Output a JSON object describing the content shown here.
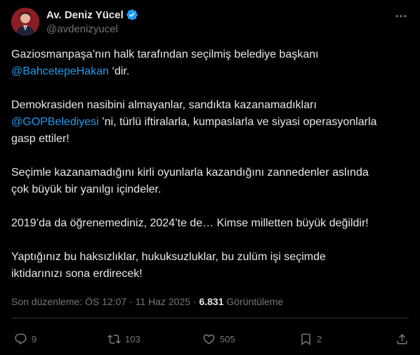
{
  "user": {
    "display_name": "Av. Deniz Yücel",
    "handle": "@avdenizyucel",
    "verified_color": "#1d9bf0"
  },
  "tweet": {
    "paragraphs": [
      {
        "lines": [
          [
            {
              "t": "Gaziosmanpaşa’nın halk tarafından seçilmiş belediye başkanı"
            }
          ],
          [
            {
              "t": "@BahcetepeHakan",
              "m": true
            },
            {
              "t": " ‘dir."
            }
          ]
        ]
      },
      {
        "lines": [
          [
            {
              "t": "Demokrasiden nasibini almayanlar, sandıkta kazanamadıkları"
            }
          ],
          [
            {
              "t": "@GOPBelediyesi",
              "m": true
            },
            {
              "t": " ’ni, türlü iftiralarla, kumpaslarla ve siyasi operasyonlarla"
            }
          ],
          [
            {
              "t": "gasp ettiler!"
            }
          ]
        ]
      },
      {
        "lines": [
          [
            {
              "t": "Seçimle kazanamadığını kirli oyunlarla kazandığını zannedenler aslında"
            }
          ],
          [
            {
              "t": "çok büyük bir yanılgı içindeler."
            }
          ]
        ]
      },
      {
        "lines": [
          [
            {
              "t": "2019’da da öğrenemediniz, 2024’te de… Kimse milletten büyük değildir!"
            }
          ]
        ]
      },
      {
        "lines": [
          [
            {
              "t": "Yaptığınız bu haksızlıklar, hukuksuzluklar, bu zulüm işi seçimde"
            }
          ],
          [
            {
              "t": "iktidarınızı sona erdirecek!"
            }
          ]
        ]
      }
    ],
    "mention_color": "#1d9bf0"
  },
  "meta": {
    "edited_time": "Son düzenleme: ÖS 12:07 · 11 Haz 2025 · ",
    "views_count": "6.831",
    "views_label": " Görüntüleme"
  },
  "actions": {
    "reply_count": "9",
    "repost_count": "103",
    "like_count": "505",
    "bookmark_count": "2"
  }
}
